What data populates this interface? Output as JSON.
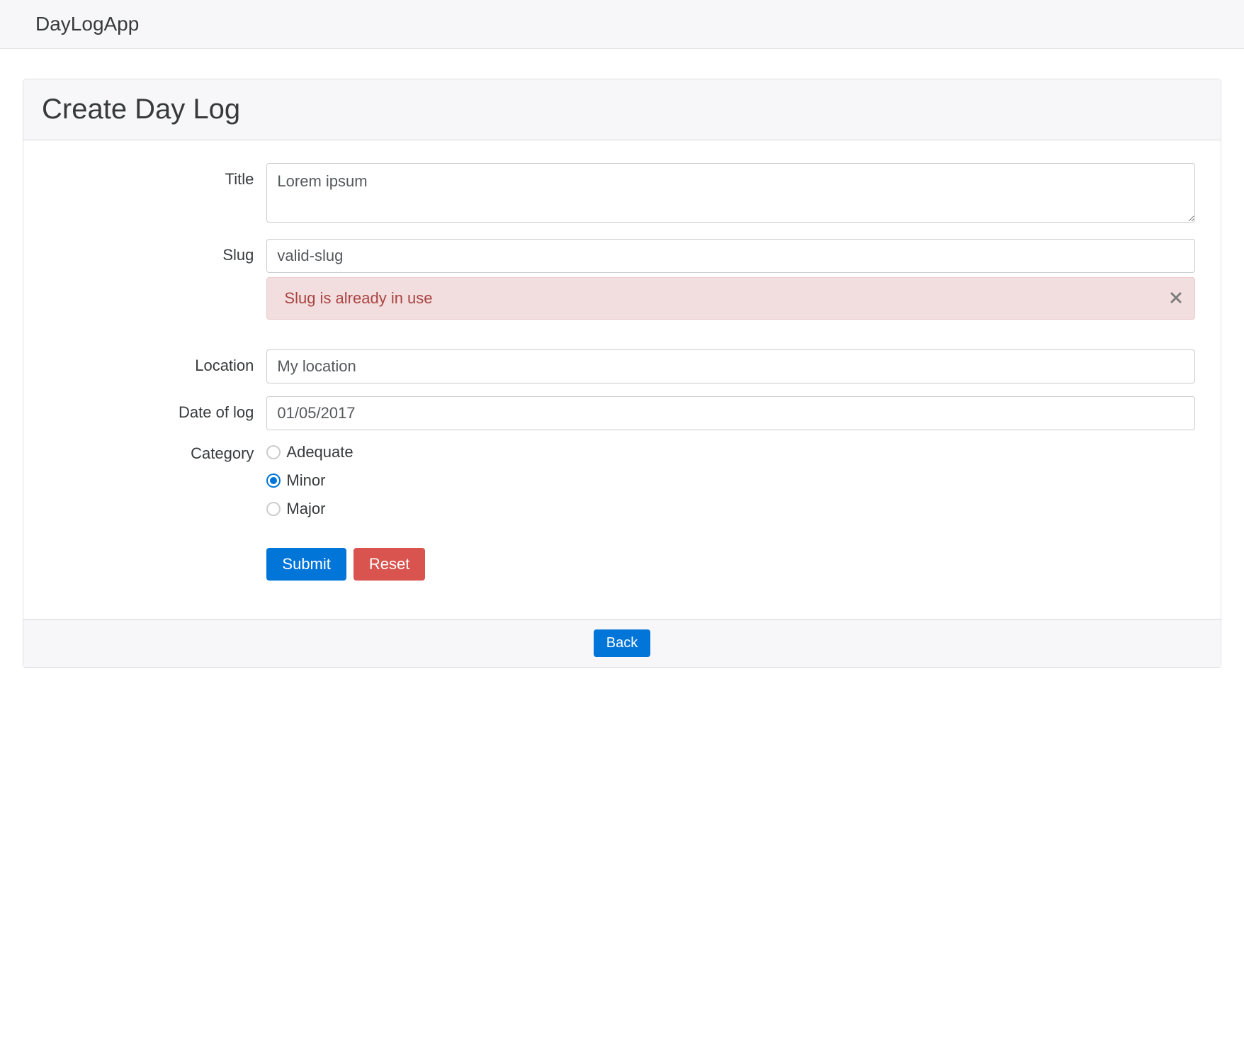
{
  "navbar": {
    "brand": "DayLogApp"
  },
  "header": {
    "title": "Create Day Log"
  },
  "form": {
    "title": {
      "label": "Title",
      "value": "Lorem ipsum"
    },
    "slug": {
      "label": "Slug",
      "value": "valid-slug",
      "error": "Slug is already in use"
    },
    "location": {
      "label": "Location",
      "value": "My location"
    },
    "date": {
      "label": "Date of log",
      "value": "01/05/2017"
    },
    "category": {
      "label": "Category",
      "options": [
        "Adequate",
        "Minor",
        "Major"
      ],
      "selected": "Minor"
    },
    "submit": "Submit",
    "reset": "Reset"
  },
  "footer": {
    "back": "Back"
  }
}
